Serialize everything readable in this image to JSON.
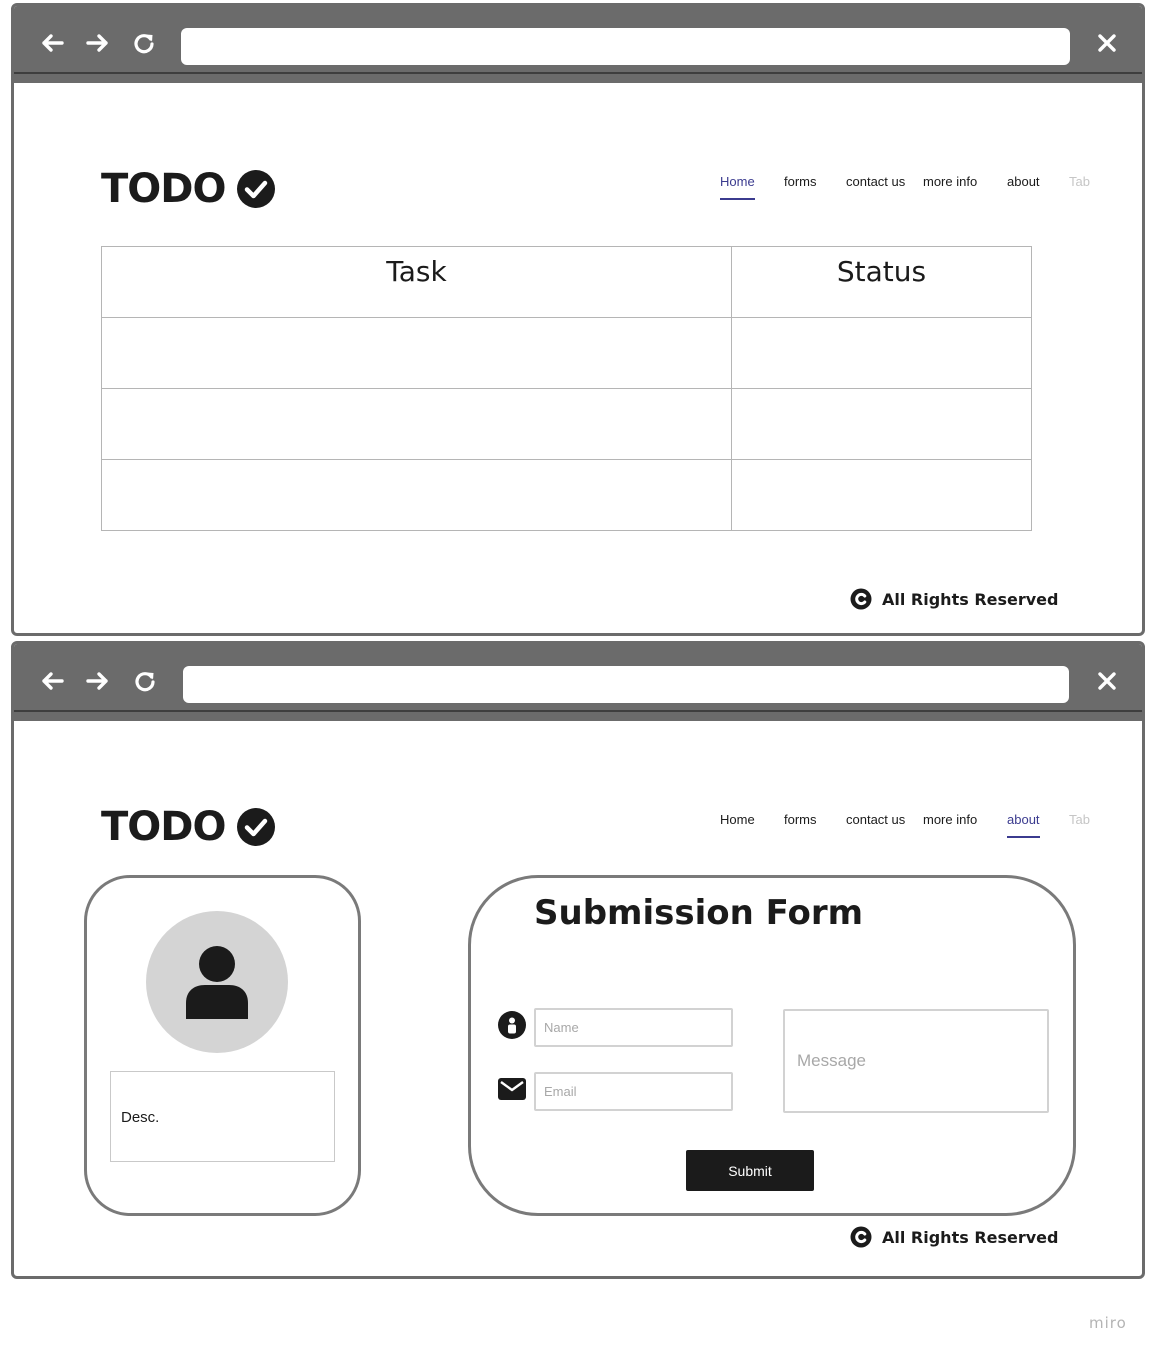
{
  "logo": {
    "text": "TODO",
    "icon": "check-circle-icon"
  },
  "browser": {
    "icons": [
      "arrow-left-icon",
      "arrow-right-icon",
      "refresh-icon",
      "close-icon"
    ],
    "url": ""
  },
  "nav": {
    "home": "Home",
    "forms": "forms",
    "contact": "contact us",
    "more_info": "more info",
    "about": "about",
    "tab": "Tab"
  },
  "page1": {
    "active_tab": "Home",
    "table": {
      "headers": [
        "Task",
        "Status"
      ],
      "rows": [
        [
          "",
          ""
        ],
        [
          "",
          ""
        ],
        [
          "",
          ""
        ]
      ]
    }
  },
  "page2": {
    "active_tab": "about",
    "profile": {
      "desc": "Desc."
    },
    "form": {
      "title": "Submission Form",
      "name_placeholder": "Name",
      "email_placeholder": "Email",
      "message_placeholder": "Message",
      "submit_label": "Submit"
    }
  },
  "footer": {
    "text": "All Rights Reserved",
    "icon": "copyright-icon"
  },
  "watermark": "miro",
  "colors": {
    "chrome": "#6b6b6b",
    "active_tab": "#3b3b8f",
    "button": "#1b1b1b",
    "avatar_bg": "#d4d4d4"
  }
}
